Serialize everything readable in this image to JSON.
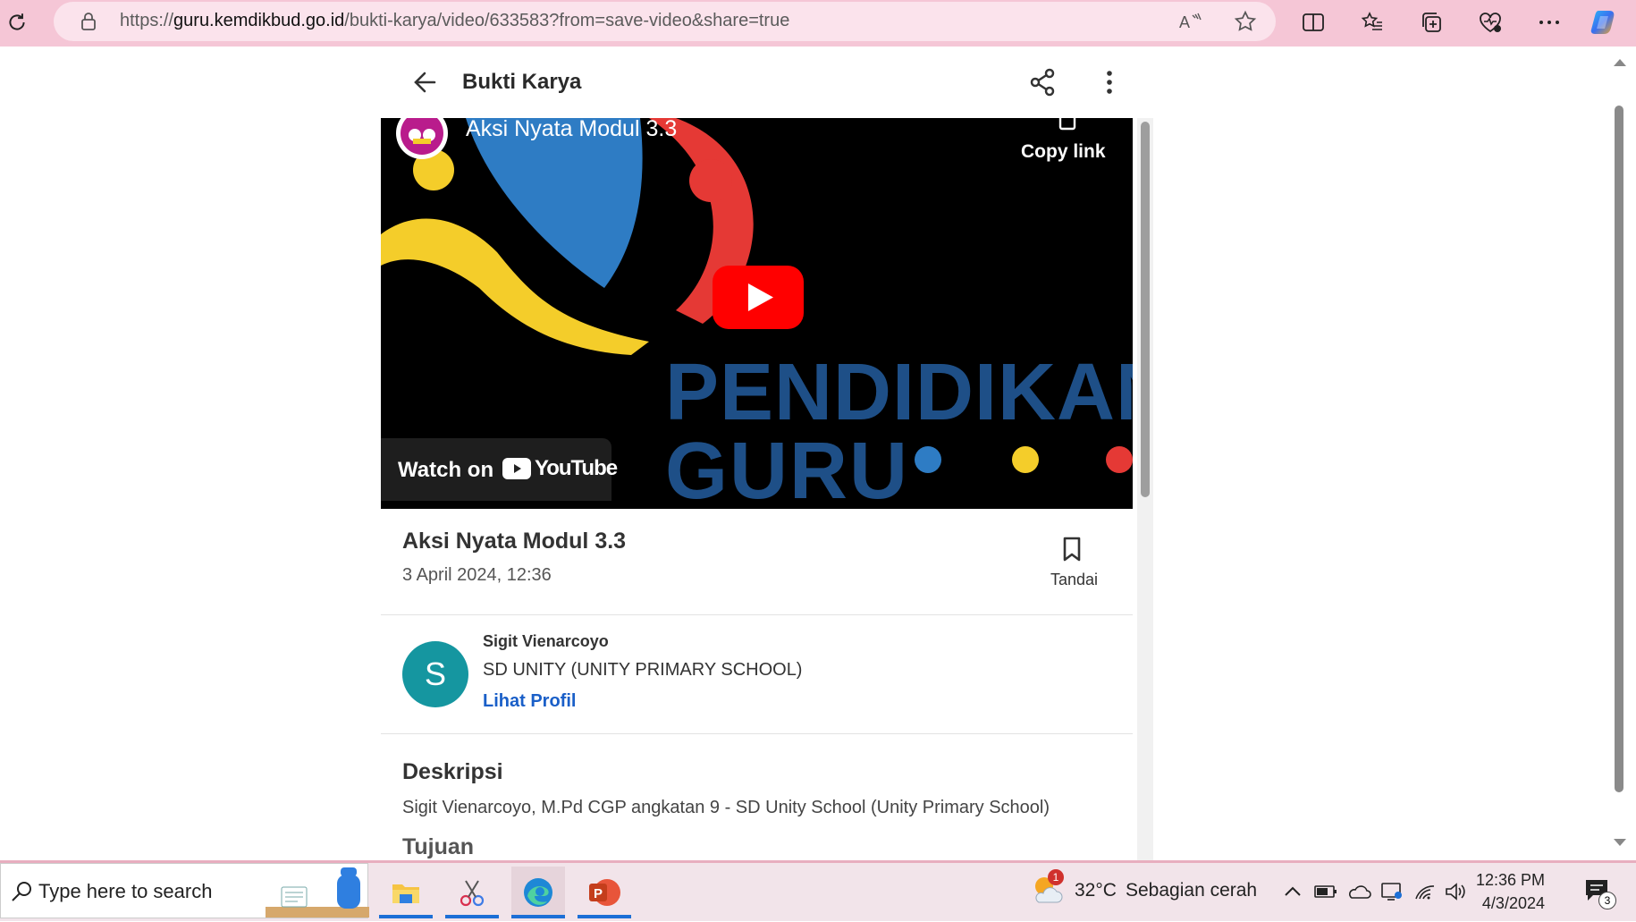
{
  "browser": {
    "url_prefix": "https://",
    "url_host": "guru.kemdikbud.go.id",
    "url_path": "/bukti-karya/video/633583?from=save-video&share=true"
  },
  "header": {
    "title": "Bukti Karya"
  },
  "video": {
    "title": "Aksi Nyata Modul 3.3",
    "copy_link": "Copy link",
    "watch_on": "Watch on",
    "youtube": "YouTube",
    "thumb_text_1": "PENDIDIKAN",
    "thumb_text_2": "GURU"
  },
  "work": {
    "title": "Aksi Nyata Modul 3.3",
    "date": "3 April 2024, 12:36",
    "bookmark_label": "Tandai"
  },
  "author": {
    "initial": "S",
    "name": "Sigit Vienarcoyo",
    "school": "SD UNITY (UNITY PRIMARY SCHOOL)",
    "profile_link": "Lihat Profil"
  },
  "description": {
    "heading": "Deskripsi",
    "text": "Sigit Vienarcoyo, M.Pd CGP angkatan 9 - SD Unity School (Unity Primary School)",
    "next_heading": "Tujuan"
  },
  "taskbar": {
    "search_placeholder": "Type here to search",
    "weather_badge": "1",
    "temperature": "32°C",
    "weather": "Sebagian cerah",
    "time": "12:36 PM",
    "date": "4/3/2024",
    "notifications": "3"
  },
  "colors": {
    "browser_bar": "#f5c6d6",
    "link": "#1a5fc8",
    "avatar": "#1596a0",
    "yt_red": "#ff0000",
    "guru_blue": "#1e4f87"
  }
}
